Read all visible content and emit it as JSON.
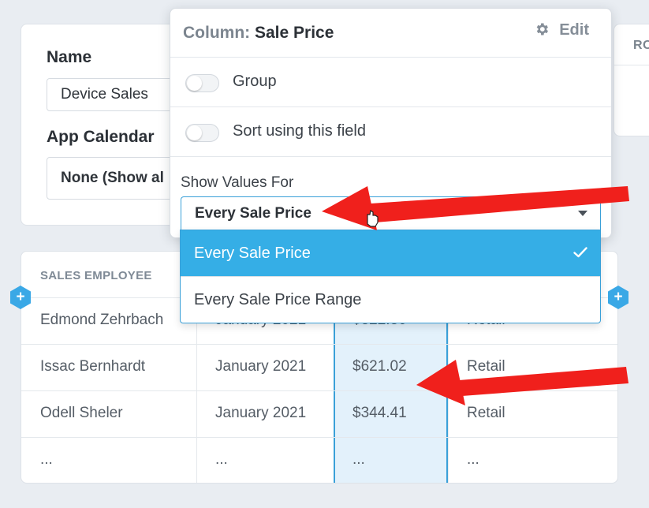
{
  "settings": {
    "name_label": "Name",
    "name_value": "Device Sales",
    "calendar_label": "App Calendar",
    "calendar_value": "None (Show al"
  },
  "right_panel": {
    "header_partial": "RO"
  },
  "table": {
    "columns": [
      "SALES EMPLOYEE",
      "",
      "",
      ""
    ],
    "rows": [
      [
        "Edmond Zehrbach",
        "January 2021",
        "$322.30",
        "Retail"
      ],
      [
        "Issac Bernhardt",
        "January 2021",
        "$621.02",
        "Retail"
      ],
      [
        "Odell Sheler",
        "January 2021",
        "$344.41",
        "Retail"
      ],
      [
        "...",
        "...",
        "...",
        "..."
      ]
    ],
    "add_column_symbol": "+"
  },
  "popover": {
    "title_prefix": "Column:",
    "title_field": "Sale Price",
    "edit_label": "Edit",
    "edit_icon": "gear-icon",
    "toggles": [
      {
        "label": "Group",
        "on": false
      },
      {
        "label": "Sort using this field",
        "on": false
      }
    ],
    "show_values_label": "Show Values For",
    "show_values_selected": "Every Sale Price"
  },
  "dropdown": {
    "options": [
      {
        "label": "Every Sale Price",
        "selected": true
      },
      {
        "label": "Every Sale Price Range",
        "selected": false
      }
    ]
  },
  "annotations": {
    "arrow_color": "#f0201c",
    "arrow_count": 2
  },
  "colors": {
    "accent": "#35aee6",
    "highlight_column": "#e3f1fb",
    "background": "#e9edf2"
  }
}
